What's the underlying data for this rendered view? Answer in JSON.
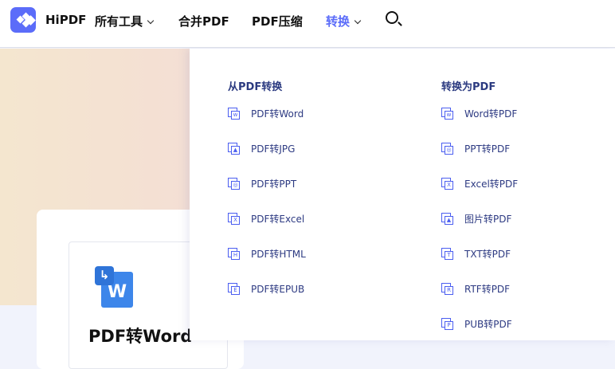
{
  "header": {
    "brand": "HiPDF",
    "nav": [
      {
        "label": "所有工具",
        "dropdown": true
      },
      {
        "label": "合并PDF"
      },
      {
        "label": "PDF压缩"
      },
      {
        "label": "转换",
        "dropdown": true,
        "active": true
      }
    ],
    "accent": "#5b6cf9"
  },
  "card": {
    "title": "PDF转Word"
  },
  "dropdown": {
    "from_pdf": {
      "title": "从PDF转换",
      "items": [
        {
          "label": "PDF转Word",
          "glyph": "w"
        },
        {
          "label": "PDF转JPG",
          "glyph": "▲"
        },
        {
          "label": "PDF转PPT",
          "glyph": "◎"
        },
        {
          "label": "PDF转Excel",
          "glyph": "X"
        },
        {
          "label": "PDF转HTML",
          "glyph": "H"
        },
        {
          "label": "PDF转EPUB",
          "glyph": "E"
        }
      ]
    },
    "to_pdf": {
      "title": "转换为PDF",
      "items": [
        {
          "label": "Word转PDF",
          "glyph": "w"
        },
        {
          "label": "PPT转PDF",
          "glyph": "◎"
        },
        {
          "label": "Excel转PDF",
          "glyph": "X"
        },
        {
          "label": "图片转PDF",
          "glyph": "▲"
        },
        {
          "label": "TXT转PDF",
          "glyph": "T"
        },
        {
          "label": "RTF转PDF",
          "glyph": "R"
        },
        {
          "label": "PUB转PDF",
          "glyph": "P"
        }
      ]
    }
  }
}
